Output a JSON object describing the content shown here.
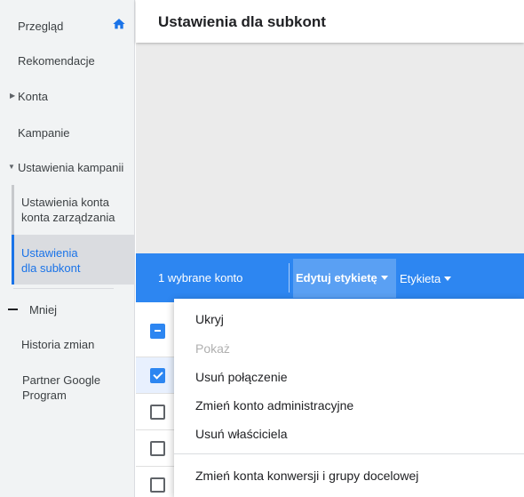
{
  "sidebar": {
    "overview": "Przegląd",
    "recommendations": "Rekomendacje",
    "accounts": "Konta",
    "campaigns": "Kampanie",
    "campaign_settings": "Ustawienia kampanii",
    "sub_manager_line1": "Ustawienia konta",
    "sub_manager_line2": "konta zarządzania",
    "sub_subaccounts_line1": "Ustawienia",
    "sub_subaccounts_line2": "dla subkont",
    "less": "Mniej",
    "change_history": "Historia zmian",
    "partner_line1": "Partner Google",
    "partner_line2": "Program"
  },
  "header": {
    "title": "Ustawienia dla subkont"
  },
  "action_bar": {
    "selected_count": "1 wybrane konto",
    "edit_label": "Edytuj etykietę",
    "label": "Etykieta"
  },
  "menu": {
    "items": [
      {
        "label": "Ukryj",
        "disabled": false
      },
      {
        "label": "Pokaż",
        "disabled": true
      },
      {
        "label": "Usuń połączenie",
        "disabled": false
      },
      {
        "label": "Zmień konto administracyjne",
        "disabled": false
      },
      {
        "label": "Usuń właściciela",
        "disabled": false
      },
      {
        "label": "Zmień konta konwersji i grupy docelowej",
        "disabled": false
      }
    ]
  },
  "colors": {
    "accent": "#2d86f1",
    "active_nav": "#1a73e8"
  }
}
